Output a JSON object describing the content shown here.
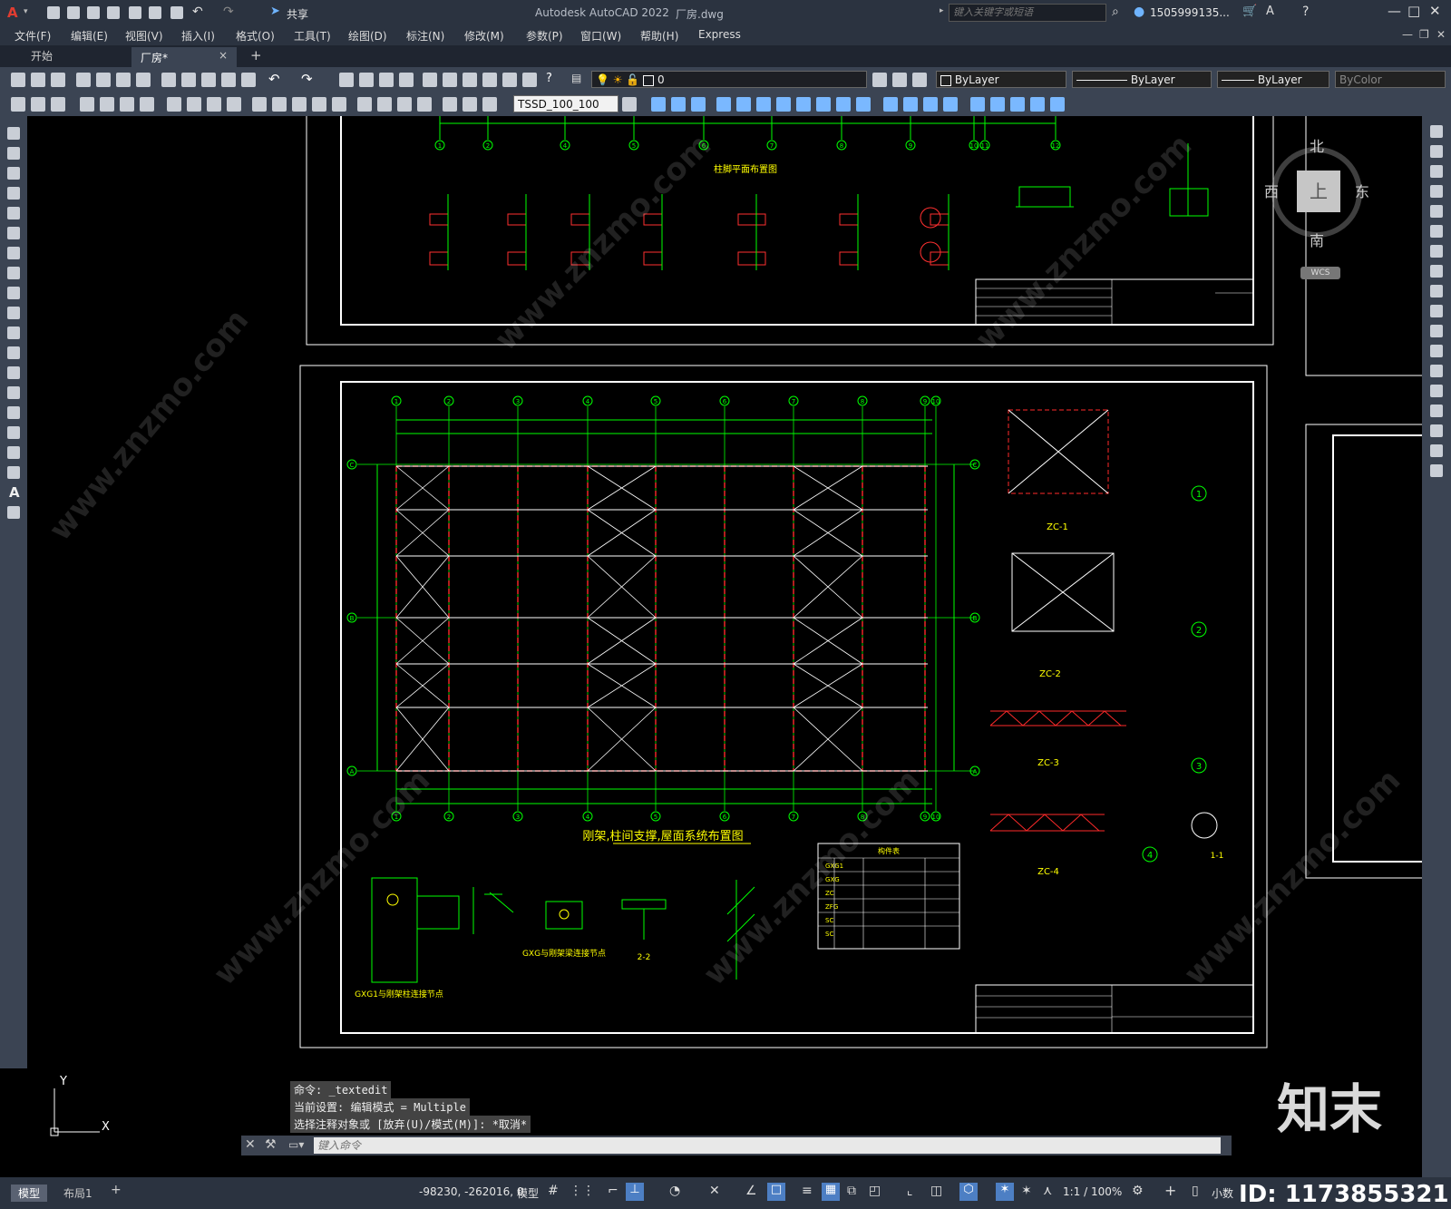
{
  "app": {
    "title": "Autodesk AutoCAD 2022",
    "filename": "厂房.dwg",
    "share_label": "共享",
    "search_placeholder": "键入关键字或短语",
    "user": "1505999135..."
  },
  "menu": [
    "文件(F)",
    "编辑(E)",
    "视图(V)",
    "插入(I)",
    "格式(O)",
    "工具(T)",
    "绘图(D)",
    "标注(N)",
    "修改(M)",
    "参数(P)",
    "窗口(W)",
    "帮助(H)",
    "Express"
  ],
  "tabs": {
    "start": "开始",
    "active": "厂房*",
    "close": "×",
    "add": "+"
  },
  "toolbar": {
    "layer_value": "0",
    "color_value": "ByLayer",
    "linetype_value": "ByLayer",
    "lineweight_value": "ByLayer",
    "plotstyle_value": "ByColor",
    "dimstyle_value": "TSSD_100_100"
  },
  "viewcube": {
    "north": "北",
    "south": "南",
    "east": "东",
    "west": "西",
    "top": "上",
    "wcs": "WCS"
  },
  "drawing": {
    "upper_plan_title": "柱脚平面布置图",
    "main_plan_title": "刚架,柱间支撑,屋面系统布置图",
    "grid_numbers": [
      "1",
      "2",
      "3",
      "4",
      "5",
      "6",
      "7",
      "8",
      "9",
      "10"
    ],
    "top_grid_numbers": [
      "1",
      "2",
      "4",
      "5",
      "6",
      "7",
      "8",
      "9",
      "10",
      "11",
      "12"
    ],
    "grid_letters": [
      "C",
      "B",
      "A"
    ],
    "detail_labels": [
      "ZC-1",
      "ZC-2",
      "ZC-3",
      "ZC-4"
    ],
    "section_labels": [
      "1",
      "2",
      "3",
      "4"
    ],
    "detail_captions": [
      "GXG1与刚架柱连接节点",
      "GXG与刚架梁连接节点",
      "2-2",
      "1-1"
    ],
    "table_title": "构件表",
    "table_rows": [
      "GXG1",
      "GXG",
      "ZC",
      "ZFG",
      "SC",
      "SC"
    ]
  },
  "command": {
    "history": [
      "命令: _textedit",
      "当前设置: 编辑模式 = Multiple",
      "选择注释对象或 [放弃(U)/模式(M)]: *取消*"
    ],
    "placeholder": "键入命令"
  },
  "layout_tabs": [
    "模型",
    "布局1",
    "+"
  ],
  "status": {
    "coords": "-98230, -262016, 0",
    "space": "模型",
    "scale": "1:1 / 100%",
    "units": "小数"
  },
  "watermark": {
    "brand": "知末",
    "id": "ID: 1173855321",
    "site": "www.znzmo.com"
  }
}
